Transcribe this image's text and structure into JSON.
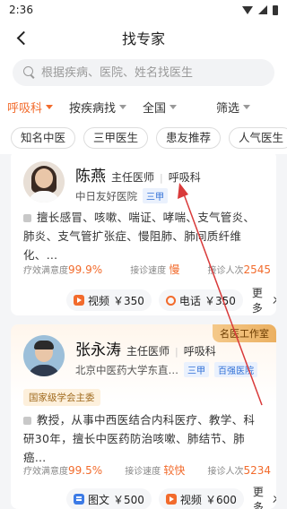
{
  "status_bar": {
    "time": "2:36"
  },
  "nav": {
    "title": "找专家"
  },
  "search": {
    "placeholder": "根据疾病、医院、姓名找医生"
  },
  "filters": [
    {
      "label": "呼吸科",
      "active": true
    },
    {
      "label": "按疾病找",
      "active": false
    },
    {
      "label": "全国",
      "active": false
    },
    {
      "label": "筛选",
      "active": false
    }
  ],
  "tags": [
    "知名中医",
    "三甲医生",
    "患友推荐",
    "人气医生"
  ],
  "doctors": [
    {
      "name": "陈燕",
      "title": "主任医师",
      "dept": "呼吸科",
      "hospital": "中日友好医院",
      "hospital_badge": "三甲",
      "description": "擅长感冒、咳嗽、喘证、哮喘、支气管炎、肺炎、支气管扩张症、慢阻肺、肺间质纤维化、…",
      "satisfaction_label": "疗效满意度",
      "satisfaction": "99.9%",
      "speed_label": "接诊速度",
      "speed": "慢",
      "patients_label": "接诊人次",
      "patients": "2545",
      "services": [
        {
          "icon": "video-icon",
          "label": "视频",
          "price": "￥350"
        },
        {
          "icon": "phone-icon",
          "label": "电话",
          "price": "￥350"
        }
      ],
      "more": "更多"
    },
    {
      "name": "张永涛",
      "title": "主任医师",
      "dept": "呼吸科",
      "hospital": "北京中医药大学东直…",
      "hospital_badge": "三甲",
      "hospital_badge2": "百强医院",
      "studio": "名医工作室",
      "honor": "国家级学会主委",
      "description": "教授，从事中西医结合内科医疗、教学、科研30年，擅长中医药防治咳嗽、肺结节、肺癌…",
      "satisfaction_label": "疗效满意度",
      "satisfaction": "99.5%",
      "speed_label": "接诊速度",
      "speed": "较快",
      "patients_label": "接诊人次",
      "patients": "5234",
      "services": [
        {
          "icon": "chat-icon",
          "label": "图文",
          "price": "￥500"
        },
        {
          "icon": "video-icon",
          "label": "视频",
          "price": "￥600"
        }
      ],
      "more": "更多"
    }
  ],
  "colors": {
    "accent": "#f26b2c",
    "annotation_arrow": "#d93a3a",
    "badge_blue": "#2f6fd6"
  }
}
